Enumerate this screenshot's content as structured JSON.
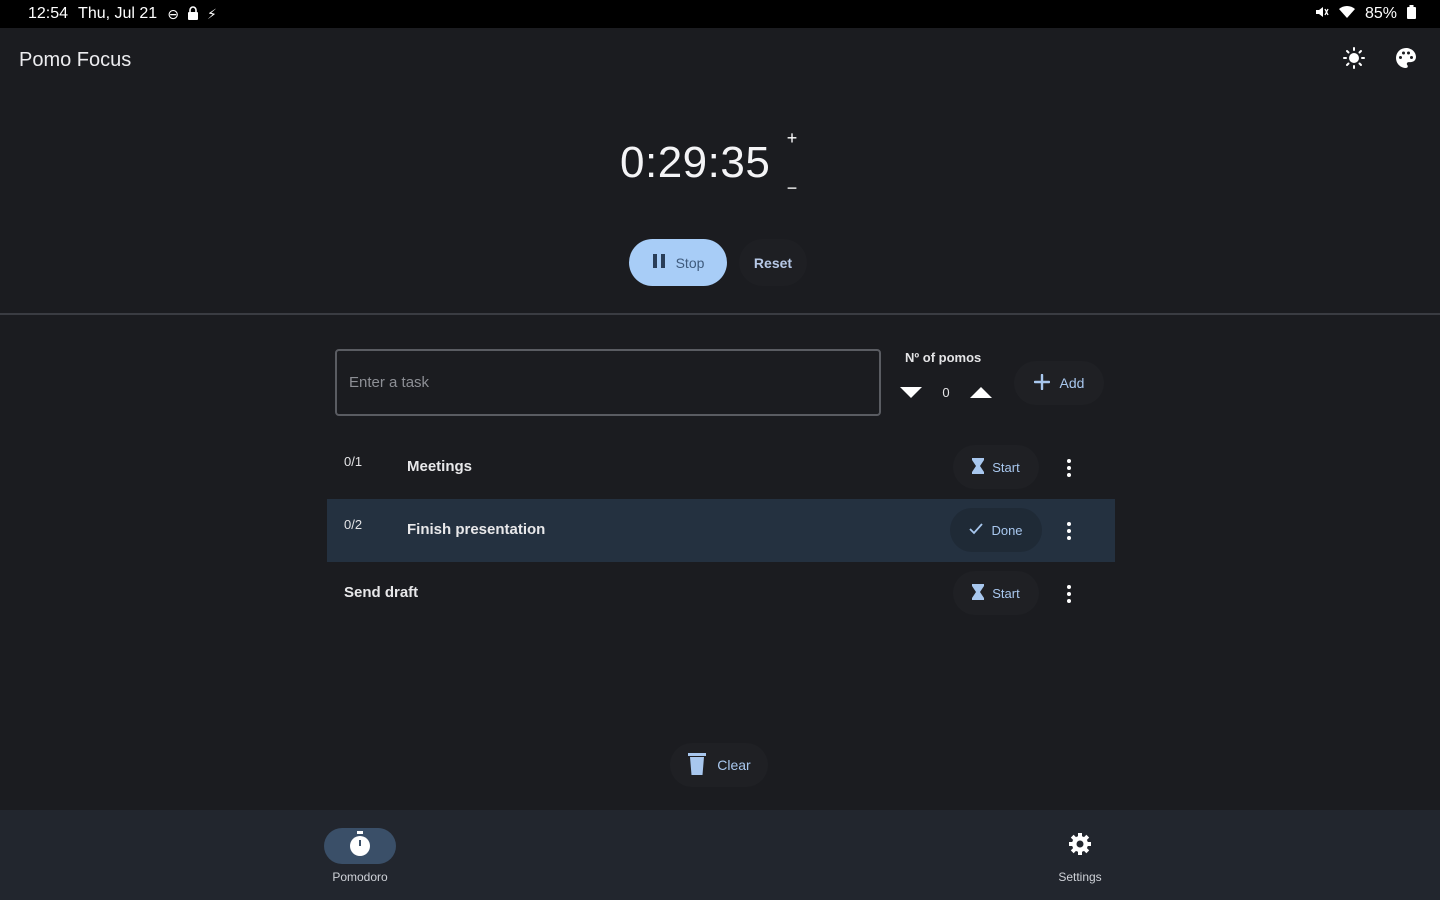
{
  "status_bar": {
    "time": "12:54",
    "date": "Thu, Jul 21",
    "battery": "85%"
  },
  "app": {
    "title": "Pomo Focus"
  },
  "timer": {
    "display": "0:29:35",
    "increment_label": "+",
    "decrement_label": "−",
    "stop_label": "Stop",
    "reset_label": "Reset"
  },
  "task_entry": {
    "placeholder": "Enter a task",
    "pomos_label": "Nº of pomos",
    "pomos_value": "0",
    "add_label": "Add"
  },
  "tasks": [
    {
      "progress": "0/1",
      "name": "Meetings",
      "action": "Start"
    },
    {
      "progress": "0/2",
      "name": "Finish presentation",
      "action": "Done"
    },
    {
      "progress": "",
      "name": "Send draft",
      "action": "Start"
    }
  ],
  "clear_label": "Clear",
  "nav": {
    "pomodoro_label": "Pomodoro",
    "settings_label": "Settings"
  },
  "colors": {
    "accent": "#a8cdf7",
    "background": "#1b1c20",
    "active_row": "#243140",
    "nav_background": "#22262e"
  }
}
